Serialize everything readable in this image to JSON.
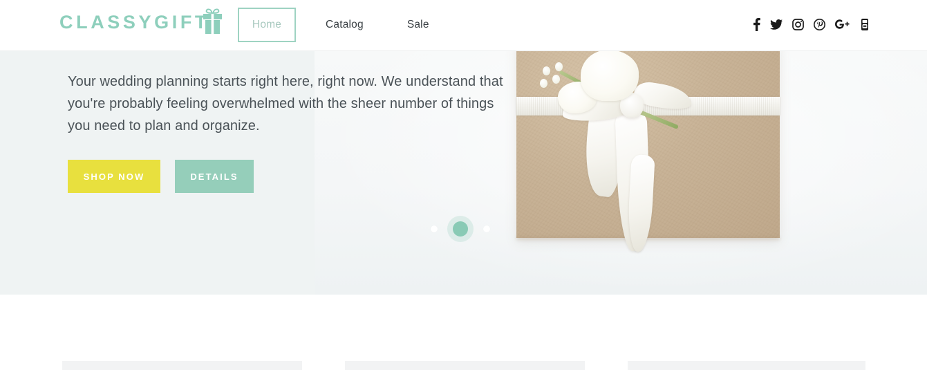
{
  "site": {
    "brand": "CLASSYGIFT",
    "brand_color": "#8ecfbc",
    "logo_icon": "gift-box-icon"
  },
  "header": {
    "nav": [
      {
        "label": "Home",
        "active": true
      },
      {
        "label": "Catalog",
        "active": false
      },
      {
        "label": "Sale",
        "active": false
      }
    ],
    "social": [
      {
        "name": "facebook-icon",
        "title": "Facebook"
      },
      {
        "name": "twitter-icon",
        "title": "Twitter"
      },
      {
        "name": "instagram-icon",
        "title": "Instagram"
      },
      {
        "name": "pinterest-icon",
        "title": "Pinterest"
      },
      {
        "name": "google-plus-icon",
        "title": "Google Plus"
      },
      {
        "name": "youtube-icon",
        "title": "YouTube"
      }
    ]
  },
  "hero": {
    "paragraph": "Your wedding planning starts right here, right now. We understand that you're probably feeling overwhelmed with the sheer number of things you need to plan and organize.",
    "primary_button": "SHOP NOW",
    "secondary_button": "DETAILS",
    "background_color": "#eff3f3",
    "primary_button_color": "#e8e03e",
    "secondary_button_color": "#95ceba",
    "image_alt": "Kraft paper wrapped gift with white ribbon bow and white flowers",
    "carousel": {
      "slide_count": 3,
      "active_index": 1,
      "active_dot_color": "#89cab5",
      "inactive_dot_color": "#ffffff"
    }
  },
  "below_fold": {
    "placeholder_count": 3,
    "placeholder_color": "#f2f3f4"
  }
}
